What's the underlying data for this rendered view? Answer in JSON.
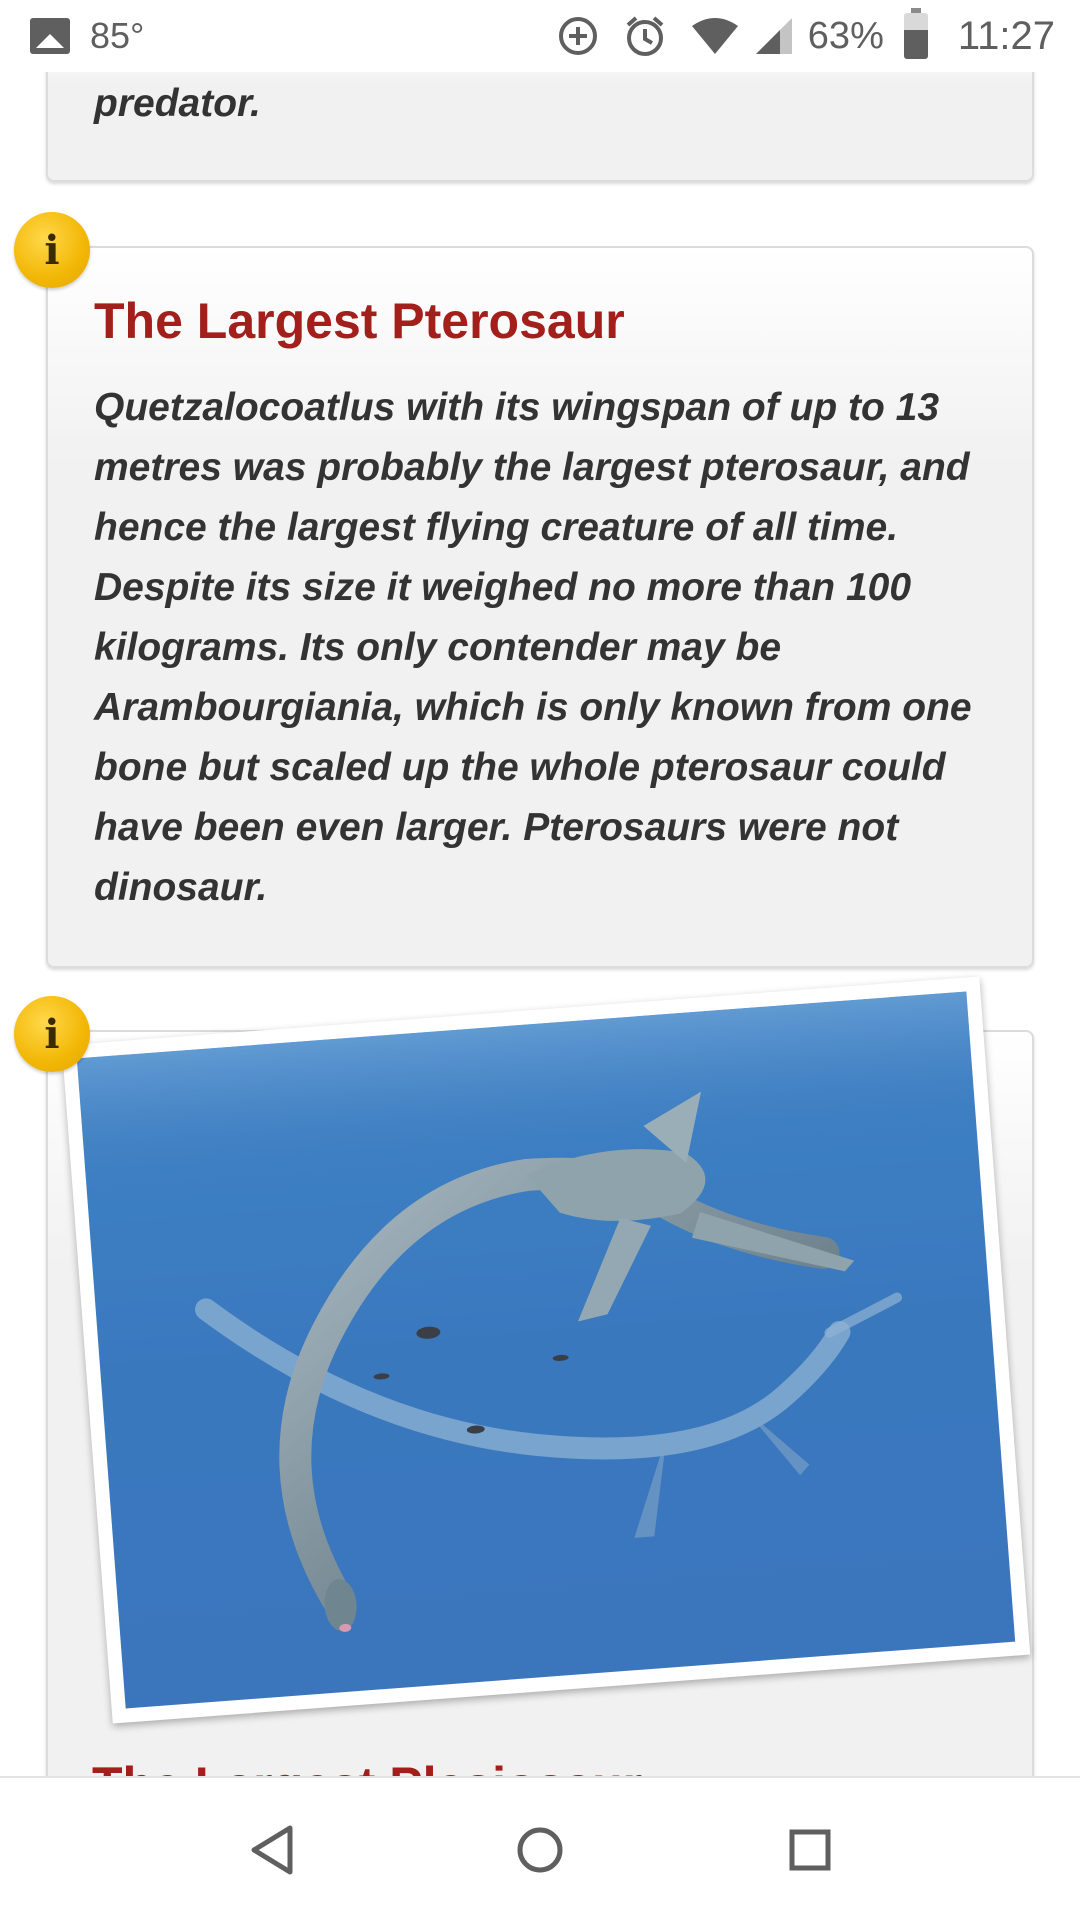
{
  "status_bar": {
    "temperature": "85°",
    "battery_percent": "63%",
    "battery_level": 0.63,
    "time": "11:27",
    "icons": [
      "gallery-icon",
      "data-saver-icon",
      "alarm-icon",
      "wifi-icon",
      "cell-signal-icon",
      "battery-icon"
    ]
  },
  "cards": {
    "top": {
      "text": "predator."
    },
    "largest_pterosaur": {
      "title": "The Largest Pterosaur",
      "body": "Quetzalocoatlus with its wingspan of up to 13 metres was probably the largest pterosaur, and hence the largest flying creature of all time. Despite its size it weighed no more than 100 kilograms. Its only contender may be Arambourgiania, which is only known from one bone but scaled up the whole pterosaur could have been even larger. Pterosaurs were not dinosaur."
    },
    "next": {
      "partial_title": "The Largest Plesiosaur",
      "image_icon": "plesiosaur-image"
    }
  },
  "info_icon_glyph": "i",
  "nav_bar": {
    "buttons": [
      "back-icon",
      "home-icon",
      "recents-icon"
    ]
  },
  "colors": {
    "title_red": "#a31f1b",
    "info_yellow": "#f2b705",
    "water_blue": "#3b78be"
  }
}
